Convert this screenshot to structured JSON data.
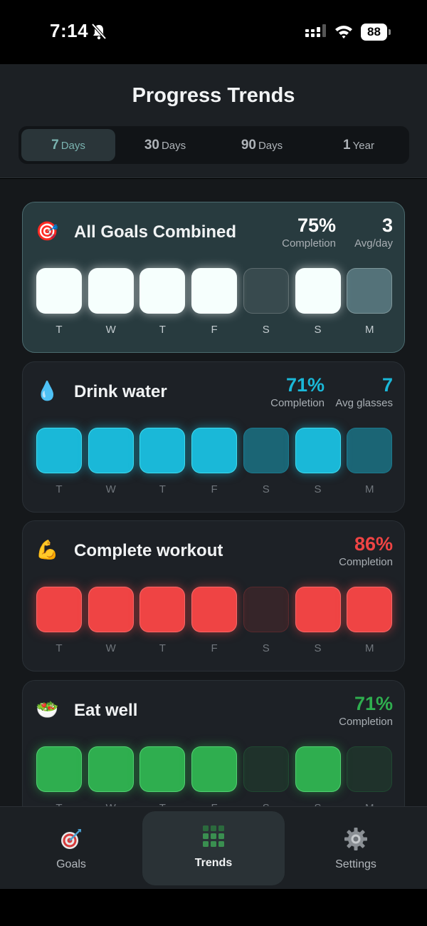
{
  "status": {
    "time": "7:14",
    "battery": "88"
  },
  "header": {
    "title": "Progress Trends",
    "segments": [
      {
        "num": "7",
        "unit": "Days",
        "active": true
      },
      {
        "num": "30",
        "unit": "Days",
        "active": false
      },
      {
        "num": "90",
        "unit": "Days",
        "active": false
      },
      {
        "num": "1",
        "unit": "Year",
        "active": false
      }
    ]
  },
  "day_labels": [
    "T",
    "W",
    "T",
    "F",
    "S",
    "S",
    "M"
  ],
  "cards": [
    {
      "emoji": "🎯",
      "icon": "target-icon",
      "title": "All Goals Combined",
      "stat1": {
        "value": "75%",
        "label": "Completion"
      },
      "stat2": {
        "value": "3",
        "label": "Avg/day"
      },
      "accent": "#ffffff",
      "days": [
        "full",
        "full",
        "full",
        "full",
        "empty",
        "full",
        "partial"
      ]
    },
    {
      "emoji": "💧",
      "icon": "water-drop-icon",
      "title": "Drink water",
      "stat1": {
        "value": "71%",
        "label": "Completion"
      },
      "stat2": {
        "value": "7",
        "label": "Avg glasses"
      },
      "accent": "#1ab8d8",
      "days": [
        "full",
        "full",
        "full",
        "full",
        "partial",
        "full",
        "partial"
      ]
    },
    {
      "emoji": "💪",
      "icon": "flexed-bicep-icon",
      "title": "Complete workout",
      "stat1": {
        "value": "86%",
        "label": "Completion"
      },
      "accent": "#ef4444",
      "days": [
        "full",
        "full",
        "full",
        "full",
        "empty",
        "full",
        "full"
      ]
    },
    {
      "emoji": "🥗",
      "icon": "salad-icon",
      "title": "Eat well",
      "stat1": {
        "value": "71%",
        "label": "Completion"
      },
      "accent": "#2fae4f",
      "days": [
        "full",
        "full",
        "full",
        "full",
        "empty",
        "full",
        "empty"
      ]
    }
  ],
  "tabs": [
    {
      "label": "Goals",
      "icon": "target-icon"
    },
    {
      "label": "Trends",
      "icon": "grid-icon"
    },
    {
      "label": "Settings",
      "icon": "gear-icon"
    }
  ]
}
